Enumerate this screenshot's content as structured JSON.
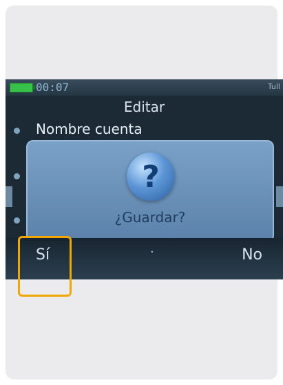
{
  "status": {
    "time": "00:07",
    "signal": "Tull"
  },
  "screen": {
    "title": "Editar"
  },
  "list": {
    "item_label": "Nombre cuenta"
  },
  "dialog": {
    "question": "¿Guardar?",
    "icon": "question-icon"
  },
  "softkeys": {
    "left": "Sí",
    "middle": "·",
    "right": "No"
  },
  "colors": {
    "highlight": "#f0a800",
    "dialog": "#6f97bf",
    "screen_bg": "#1c2a36"
  }
}
